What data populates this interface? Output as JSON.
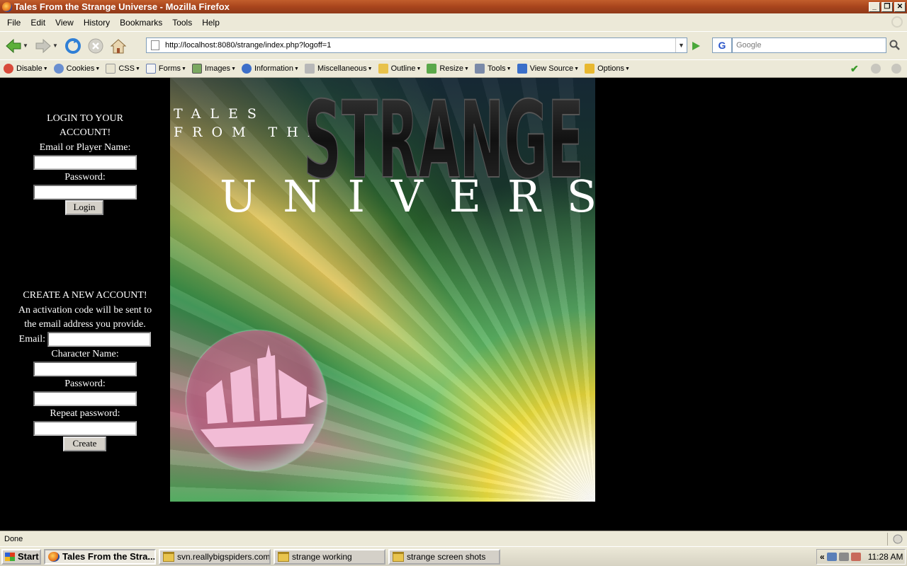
{
  "window": {
    "title": "Tales From the Strange Universe - Mozilla Firefox"
  },
  "menu": {
    "items": [
      "File",
      "Edit",
      "View",
      "History",
      "Bookmarks",
      "Tools",
      "Help"
    ]
  },
  "nav": {
    "url": "http://localhost:8080/strange/index.php?logoff=1",
    "search_placeholder": "Google",
    "search_engine": "G"
  },
  "devbar": {
    "items": [
      "Disable",
      "Cookies",
      "CSS",
      "Forms",
      "Images",
      "Information",
      "Miscellaneous",
      "Outline",
      "Resize",
      "Tools",
      "View Source",
      "Options"
    ]
  },
  "login": {
    "heading_line1": "LOGIN TO YOUR",
    "heading_line2": "ACCOUNT!",
    "email_label": "Email or Player Name:",
    "password_label": "Password:",
    "button": "Login"
  },
  "create": {
    "heading": "CREATE A NEW ACCOUNT!",
    "info_line1": "An activation code will be sent to",
    "info_line2": "the email address you provide.",
    "email_label": "Email:",
    "character_label": "Character Name:",
    "password_label": "Password:",
    "repeat_label": "Repeat password:",
    "button": "Create"
  },
  "banner": {
    "line1": "TALES",
    "line2": "FROM THE",
    "strange": "STRANGE",
    "universe": "UNIVERSE"
  },
  "status": {
    "text": "Done"
  },
  "taskbar": {
    "start": "Start",
    "tasks": [
      "Tales From the Stra...",
      "svn.reallybigspiders.com",
      "strange working",
      "strange screen shots"
    ],
    "clock": "11:28 AM"
  },
  "colors": {
    "titlebar": "#a8441c",
    "chrome": "#ece9d8",
    "page_bg": "#000000"
  }
}
